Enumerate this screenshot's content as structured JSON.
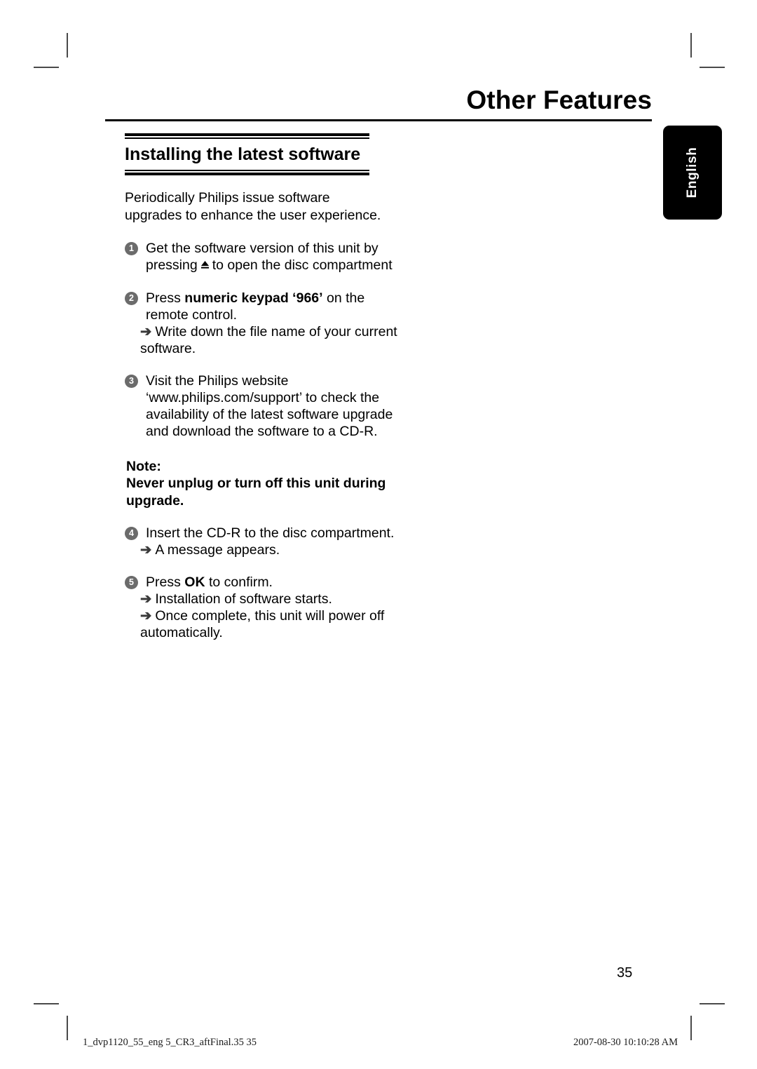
{
  "chapter": {
    "title": "Other Features"
  },
  "language_tab": {
    "label": "English"
  },
  "section": {
    "heading": "Installing the latest software",
    "intro": "Periodically Philips issue software upgrades to enhance the user experience."
  },
  "steps": [
    {
      "number": "1",
      "text_before": "Get the software version of this unit by pressing",
      "icon": "eject-icon",
      "text_after": "to open the disc compartment",
      "subs": []
    },
    {
      "number": "2",
      "text_before": "Press",
      "bold": "numeric keypad ‘966’",
      "text_after": "on the remote control.",
      "subs": [
        "Write down the file name of your current software."
      ]
    },
    {
      "number": "3",
      "text_before": "Visit the Philips website ‘www.philips.com/support’ to check the availability of the latest software upgrade and download the software to a CD-R.",
      "subs": []
    },
    {
      "number": "4",
      "text_before": "Insert the CD-R to the disc compartment.",
      "subs": [
        "A message appears."
      ]
    },
    {
      "number": "5",
      "text_before": "Press",
      "bold": "OK",
      "text_after": "to confirm.",
      "subs": [
        "Installation of software starts.",
        "Once complete, this unit will power off automatically."
      ]
    }
  ],
  "note": {
    "title": "Note:",
    "body": "Never unplug or turn off this unit during upgrade."
  },
  "arrow_glyph": "➔",
  "page_number": "35",
  "footer": {
    "left": "1_dvp1120_55_eng 5_CR3_aftFinal.35   35",
    "right": "2007-08-30   10:10:28 AM"
  },
  "colors": {
    "bullet": "#6b6b6b",
    "tab_background": "#000000",
    "rule": "#000000"
  }
}
